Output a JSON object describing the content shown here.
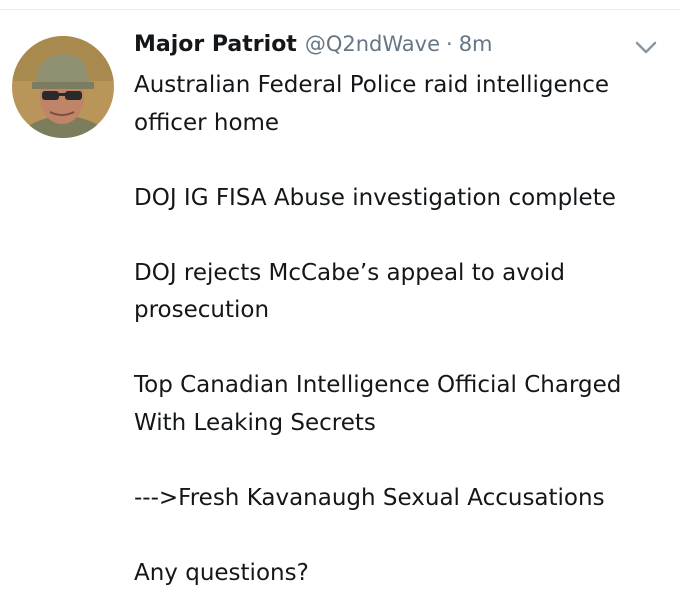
{
  "tweet": {
    "display_name": "Major Patriot",
    "handle": "@Q2ndWave",
    "separator": "·",
    "timestamp": "8m",
    "avatar_icon": "profile-photo-soldier",
    "menu_icon": "chevron-down-icon",
    "paragraphs": [
      "Australian Federal Police raid intelligence\nofficer home",
      "DOJ IG FISA Abuse investigation complete",
      "DOJ rejects McCabe’s appeal to avoid\nprosecution",
      "Top Canadian Intelligence Official Charged\nWith Leaking Secrets",
      "--->Fresh Kavanaugh Sexual Accusations",
      "Any questions?"
    ]
  },
  "colors": {
    "text": "#14171a",
    "secondary": "#657786",
    "divider": "#e6ecf0"
  }
}
